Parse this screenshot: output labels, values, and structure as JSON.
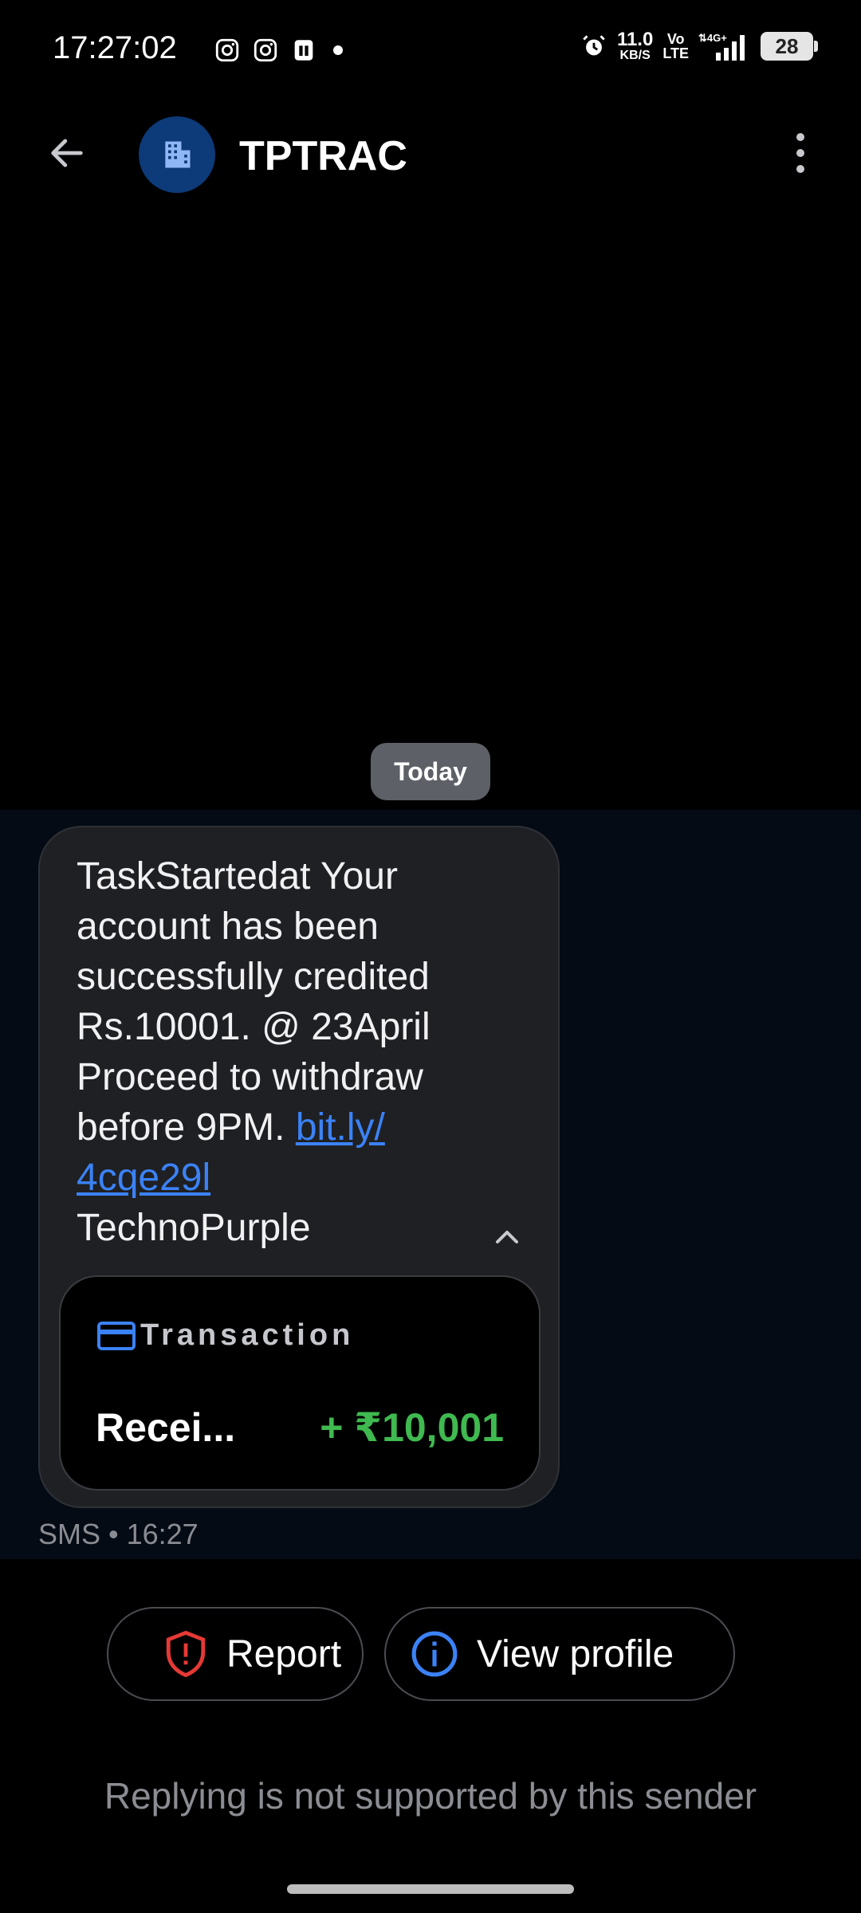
{
  "status_bar": {
    "time": "17:27:02",
    "net_speed_value": "11.0",
    "net_speed_unit": "KB/S",
    "volte_top": "Vo",
    "volte_bottom": "LTE",
    "network": "4G+",
    "battery": "28",
    "icons": [
      "instagram-icon",
      "instagram-icon",
      "sim-icon",
      "dot",
      "alarm-icon",
      "signal-icon"
    ]
  },
  "app_bar": {
    "sender": "TPTRAC",
    "avatar_icon": "building-icon"
  },
  "conversation": {
    "date_chip": "Today",
    "message": {
      "text_before_link": "TaskStartedat Your account has been successfully credited Rs.10001. @ 23April Proceed to withdraw before 9PM. ",
      "link": "bit.ly/4cqe29l",
      "link_line1": "bit.ly/",
      "link_line2": "4cqe29l",
      "signature": "TechnoPurple",
      "meta": "SMS • 16:27"
    },
    "transaction_card": {
      "title": "Transaction",
      "label": "Recei...",
      "amount": "+ ₹10,001"
    }
  },
  "actions": {
    "report_label": "Report",
    "view_profile_label": "View profile"
  },
  "footer": {
    "reply_note": "Replying is not supported by this sender"
  },
  "colors": {
    "background": "#000000",
    "bubble": "#1f2023",
    "link": "#3b82f6",
    "amount": "#3fb950",
    "report_icon": "#e53935",
    "info_icon": "#3b82f6",
    "avatar": "#0d3a78"
  }
}
